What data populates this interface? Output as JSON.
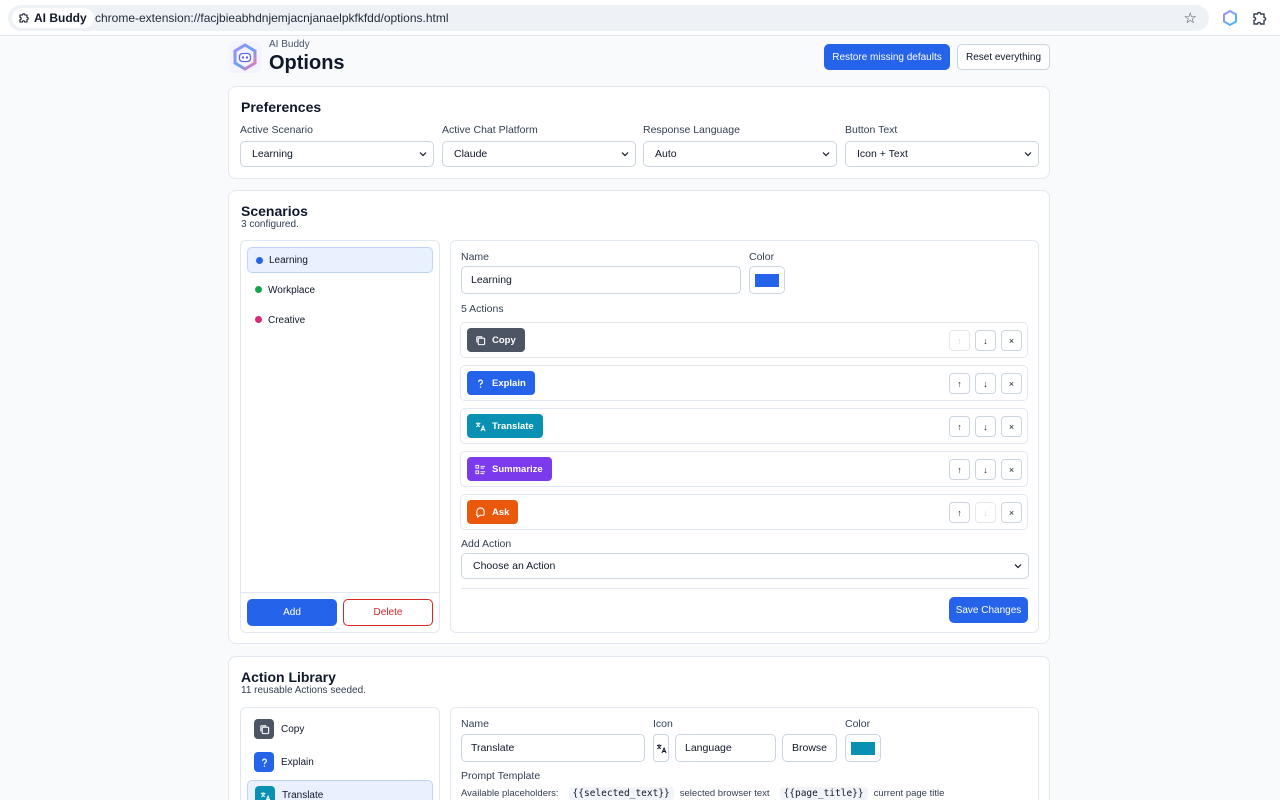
{
  "browser": {
    "site_label": "AI Buddy",
    "url": "chrome-extension://facjbieabhdnjemjacnjanaelpkfkfdd/options.html"
  },
  "header": {
    "app_name": "AI Buddy",
    "title": "Options",
    "restore_label": "Restore missing defaults",
    "reset_label": "Reset everything"
  },
  "preferences": {
    "title": "Preferences",
    "fields": [
      {
        "label": "Active Scenario",
        "value": "Learning"
      },
      {
        "label": "Active Chat Platform",
        "value": "Claude"
      },
      {
        "label": "Response Language",
        "value": "Auto"
      },
      {
        "label": "Button Text",
        "value": "Icon + Text"
      }
    ]
  },
  "scenarios": {
    "title": "Scenarios",
    "subtitle": "3 configured.",
    "items": [
      {
        "label": "Learning",
        "color": "#2563eb"
      },
      {
        "label": "Workplace",
        "color": "#16a34a"
      },
      {
        "label": "Creative",
        "color": "#db2777"
      }
    ],
    "add_label": "Add",
    "delete_label": "Delete",
    "editor": {
      "name_label": "Name",
      "name_value": "Learning",
      "color_label": "Color",
      "color_value": "#2563eb",
      "actions_label": "5 Actions",
      "actions": [
        {
          "label": "Copy",
          "color": "#4b5563",
          "icon": "copy-icon"
        },
        {
          "label": "Explain",
          "color": "#2563eb",
          "icon": "question-icon"
        },
        {
          "label": "Translate",
          "color": "#0891b2",
          "icon": "translate-icon"
        },
        {
          "label": "Summarize",
          "color": "#7c3aed",
          "icon": "list-icon"
        },
        {
          "label": "Ask",
          "color": "#ea580c",
          "icon": "chat-icon"
        }
      ],
      "move_up": "↑",
      "move_down": "↓",
      "remove": "×",
      "add_action_label": "Add Action",
      "add_action_value": "Choose an Action",
      "save_label": "Save Changes"
    }
  },
  "library": {
    "title": "Action Library",
    "subtitle": "11 reusable Actions seeded.",
    "items": [
      {
        "label": "Copy",
        "color": "#4b5563",
        "icon": "copy-icon"
      },
      {
        "label": "Explain",
        "color": "#2563eb",
        "icon": "question-icon"
      },
      {
        "label": "Translate",
        "color": "#0891b2",
        "icon": "translate-icon"
      }
    ],
    "editor": {
      "name_label": "Name",
      "name_value": "Translate",
      "icon_label": "Icon",
      "icon_value": "Language",
      "browse_label": "Browse",
      "color_label": "Color",
      "color_value": "#0891b2",
      "prompt_label": "Prompt Template",
      "placeholders_label": "Available placeholders:",
      "placeholders": [
        {
          "code": "{{selected_text}}",
          "desc": "selected browser text"
        },
        {
          "code": "{{page_title}}",
          "desc": "current page title"
        }
      ]
    }
  }
}
